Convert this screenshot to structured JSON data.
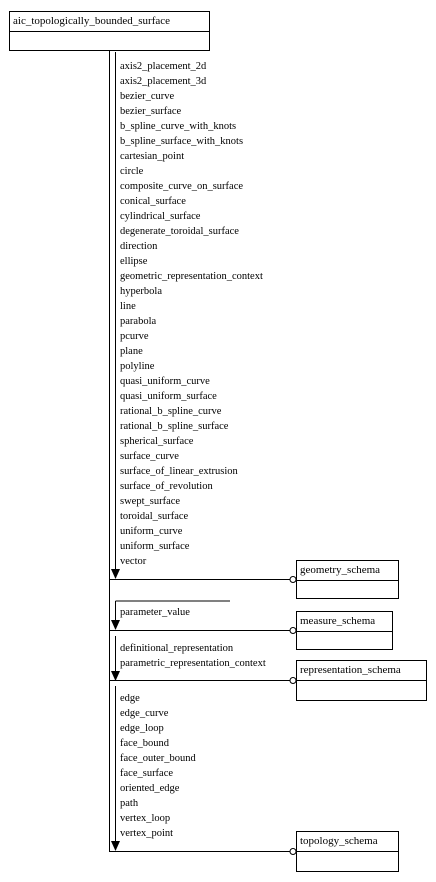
{
  "main_entity": "aic_topologically_bounded_surface",
  "groups": [
    {
      "schema": "geometry_schema",
      "items": [
        "axis2_placement_2d",
        "axis2_placement_3d",
        "bezier_curve",
        "bezier_surface",
        "b_spline_curve_with_knots",
        "b_spline_surface_with_knots",
        "cartesian_point",
        "circle",
        "composite_curve_on_surface",
        "conical_surface",
        "cylindrical_surface",
        "degenerate_toroidal_surface",
        "direction",
        "ellipse",
        "geometric_representation_context",
        "hyperbola",
        "line",
        "parabola",
        "pcurve",
        "plane",
        "polyline",
        "quasi_uniform_curve",
        "quasi_uniform_surface",
        "rational_b_spline_curve",
        "rational_b_spline_surface",
        "spherical_surface",
        "surface_curve",
        "surface_of_linear_extrusion",
        "surface_of_revolution",
        "swept_surface",
        "toroidal_surface",
        "uniform_curve",
        "uniform_surface",
        "vector"
      ]
    },
    {
      "schema": "measure_schema",
      "items": [
        "parameter_value"
      ]
    },
    {
      "schema": "representation_schema",
      "items": [
        "definitional_representation",
        "parametric_representation_context"
      ]
    },
    {
      "schema": "topology_schema",
      "items": [
        "edge",
        "edge_curve",
        "edge_loop",
        "face_bound",
        "face_outer_bound",
        "face_surface",
        "oriented_edge",
        "path",
        "vertex_loop",
        "vertex_point"
      ]
    }
  ]
}
